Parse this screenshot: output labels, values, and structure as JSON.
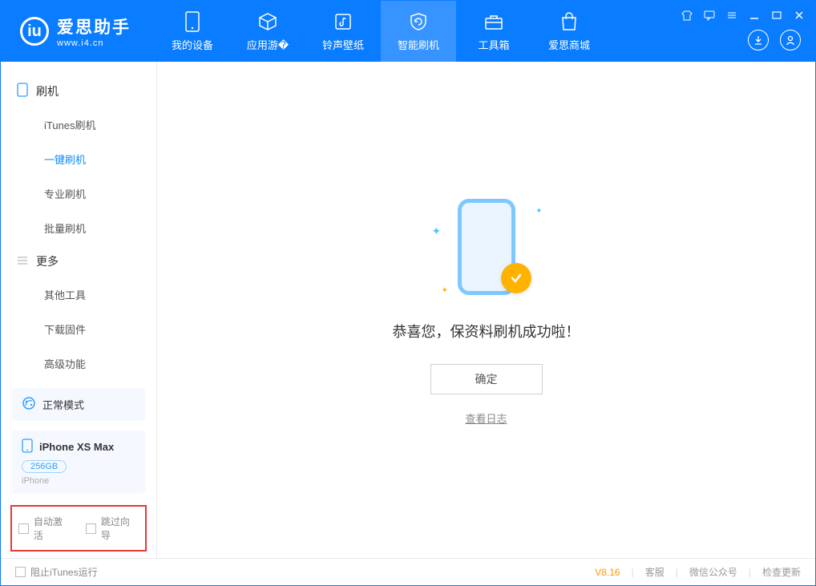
{
  "app": {
    "title": "爱思助手",
    "url": "www.i4.cn"
  },
  "nav": [
    {
      "label": "我的设备",
      "icon": "device"
    },
    {
      "label": "应用游�",
      "icon": "apps"
    },
    {
      "label": "铃声壁纸",
      "icon": "wallpaper"
    },
    {
      "label": "智能刷机",
      "icon": "flash",
      "selected": true
    },
    {
      "label": "工具箱",
      "icon": "toolbox"
    },
    {
      "label": "爱思商城",
      "icon": "store"
    }
  ],
  "sidebar": {
    "groups": [
      {
        "title": "刷机",
        "icon": "phone",
        "items": [
          {
            "label": "iTunes刷机"
          },
          {
            "label": "一键刷机",
            "active": true
          },
          {
            "label": "专业刷机"
          },
          {
            "label": "批量刷机"
          }
        ]
      },
      {
        "title": "更多",
        "icon": "more",
        "items": [
          {
            "label": "其他工具"
          },
          {
            "label": "下载固件"
          },
          {
            "label": "高级功能"
          }
        ]
      }
    ],
    "mode_label": "正常模式",
    "device": {
      "name": "iPhone XS Max",
      "capacity": "256GB",
      "type": "iPhone"
    },
    "checks": {
      "auto_activate": "自动激活",
      "skip_guide": "跳过向导"
    }
  },
  "main": {
    "success_message": "恭喜您，保资料刷机成功啦！",
    "ok_button": "确定",
    "view_log": "查看日志"
  },
  "statusbar": {
    "block_itunes": "阻止iTunes运行",
    "version": "V8.16",
    "links": [
      "客服",
      "微信公众号",
      "检查更新"
    ]
  }
}
